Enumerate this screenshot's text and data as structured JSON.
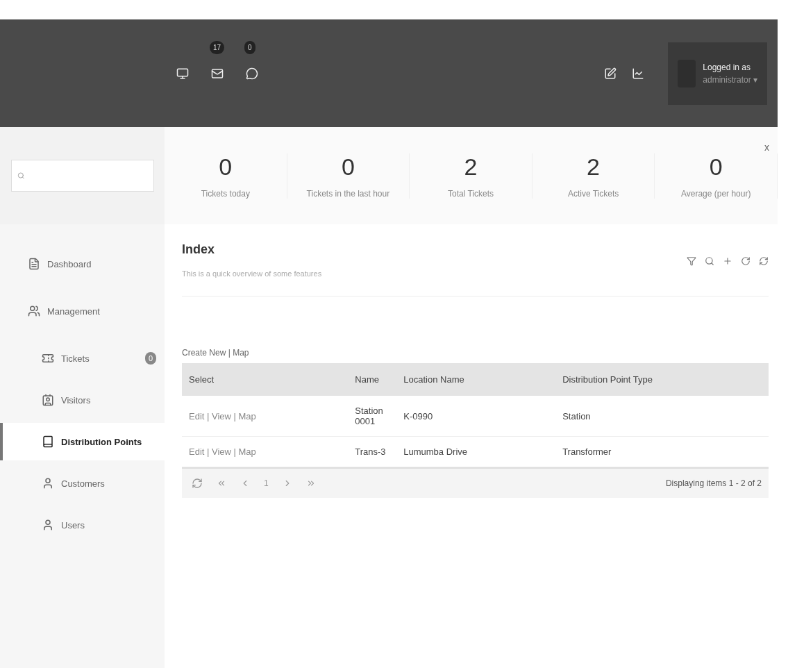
{
  "header": {
    "notifications": [
      {
        "kind": "monitor"
      },
      {
        "kind": "mail",
        "badge": "17"
      },
      {
        "kind": "chat",
        "badge": "0"
      }
    ],
    "user": {
      "label": "Logged in as",
      "name": "administrator ▾"
    }
  },
  "stats": [
    {
      "value": "0",
      "label": "Tickets today"
    },
    {
      "value": "0",
      "label": "Tickets in the last hour"
    },
    {
      "value": "2",
      "label": "Total Tickets"
    },
    {
      "value": "2",
      "label": "Active Tickets"
    },
    {
      "value": "0",
      "label": "Average (per hour)"
    }
  ],
  "stats_close": "x",
  "sidebar": {
    "items": [
      {
        "label": "Dashboard",
        "selected": false
      },
      {
        "label": "Management",
        "selected": false,
        "children": [
          {
            "label": "Tickets",
            "selected": false,
            "badge": "0"
          },
          {
            "label": "Visitors",
            "selected": false
          },
          {
            "label": "Distribution Points",
            "selected": true
          },
          {
            "label": "Customers",
            "selected": false
          },
          {
            "label": "Users",
            "selected": false
          }
        ]
      }
    ]
  },
  "page": {
    "title": "Index",
    "subtitle": "This is a quick overview of some features"
  },
  "table": {
    "caption": "Create New | Map",
    "columns": [
      "Select",
      "Name",
      "Location Name",
      "Distribution Point Type"
    ],
    "rows": [
      [
        "Edit | View | Map",
        "Station 0001",
        "K-0990",
        "Station"
      ],
      [
        "Edit | View | Map",
        "Trans-3",
        "Lumumba Drive",
        "Transformer"
      ]
    ],
    "pager": {
      "page": "1",
      "summary": "Displaying items 1 - 2 of 2"
    }
  }
}
